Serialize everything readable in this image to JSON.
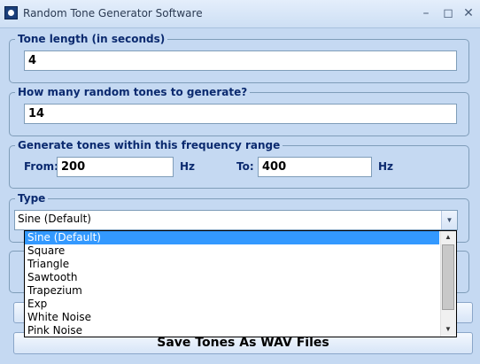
{
  "window": {
    "title": "Random Tone Generator Software"
  },
  "tone_length": {
    "label": "Tone length (in seconds)",
    "value": "4"
  },
  "tone_count": {
    "label": "How many random tones to generate?",
    "value": "14"
  },
  "frequency": {
    "label": "Generate tones within this frequency range",
    "from_label": "From:",
    "from_value": "200",
    "from_unit": "Hz",
    "to_label": "To:",
    "to_value": "400",
    "to_unit": "Hz"
  },
  "type": {
    "label": "Type",
    "selected": "Sine (Default)",
    "options": [
      "Sine (Default)",
      "Square",
      "Triangle",
      "Sawtooth",
      "Trapezium",
      "Exp",
      "White Noise",
      "Pink Noise"
    ]
  },
  "actions": {
    "save_label": "Save Tones As WAV Files"
  },
  "icons": {
    "app": "tone-generator-icon",
    "minimize": "minimize-icon",
    "maximize": "maximize-icon",
    "close": "close-icon",
    "dropdown": "chevron-down-icon",
    "scroll_up": "scroll-up-icon",
    "scroll_down": "scroll-down-icon"
  },
  "colors": {
    "background": "#c5d9f2",
    "label": "#0b2a6f",
    "selection": "#3399ff"
  }
}
